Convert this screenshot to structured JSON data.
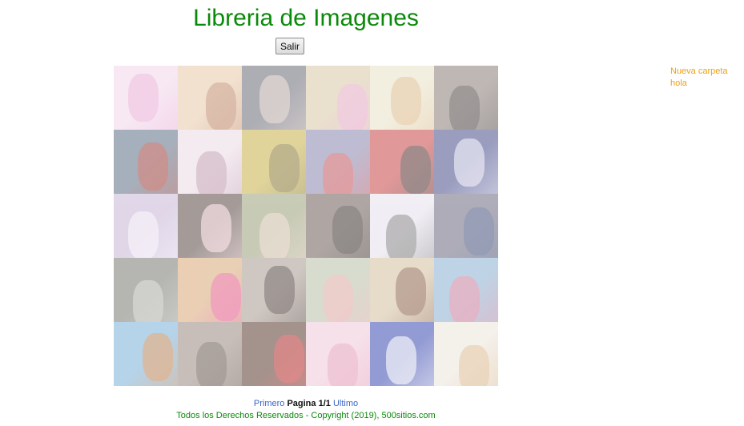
{
  "header": {
    "title": "Libreria de Imagenes",
    "logout_label": "Salir"
  },
  "gallery": {
    "columns": 6,
    "rows": 5,
    "thumbnails": [
      {
        "name": "thumb-1",
        "bg": "#f1d6ea",
        "accent": "#e8a0d0"
      },
      {
        "name": "thumb-2",
        "bg": "#e9c9a8",
        "accent": "#b5785a"
      },
      {
        "name": "thumb-3",
        "bg": "#6b6b78",
        "accent": "#c9b8b0"
      },
      {
        "name": "thumb-4",
        "bg": "#d8c7a6",
        "accent": "#e6a0c8"
      },
      {
        "name": "thumb-5",
        "bg": "#e9e2c8",
        "accent": "#d9b07a"
      },
      {
        "name": "thumb-6",
        "bg": "#8a7e78",
        "accent": "#3d3434"
      },
      {
        "name": "thumb-7",
        "bg": "#5f6f86",
        "accent": "#a83228"
      },
      {
        "name": "thumb-8",
        "bg": "#ecdce6",
        "accent": "#b48aa0"
      },
      {
        "name": "thumb-9",
        "bg": "#c9b24a",
        "accent": "#7a6a2c"
      },
      {
        "name": "thumb-10",
        "bg": "#8a87b0",
        "accent": "#d04848"
      },
      {
        "name": "thumb-11",
        "bg": "#c84444",
        "accent": "#3a2a2a"
      },
      {
        "name": "thumb-12",
        "bg": "#4a4e8c",
        "accent": "#d2d0e8"
      },
      {
        "name": "thumb-13",
        "bg": "#c7b6d6",
        "accent": "#efe6f4"
      },
      {
        "name": "thumb-14",
        "bg": "#5a4a44",
        "accent": "#e8c0c8"
      },
      {
        "name": "thumb-15",
        "bg": "#9aa07a",
        "accent": "#d9c4b0"
      },
      {
        "name": "thumb-16",
        "bg": "#6e5e58",
        "accent": "#2e2622"
      },
      {
        "name": "thumb-17",
        "bg": "#e6e0ec",
        "accent": "#6a6a6a"
      },
      {
        "name": "thumb-18",
        "bg": "#6e6a80",
        "accent": "#3a4a7a"
      },
      {
        "name": "thumb-19",
        "bg": "#7a7a74",
        "accent": "#b8b8b0"
      },
      {
        "name": "thumb-20",
        "bg": "#d8a878",
        "accent": "#e44a8a"
      },
      {
        "name": "thumb-21",
        "bg": "#a89a90",
        "accent": "#3a2a26"
      },
      {
        "name": "thumb-22",
        "bg": "#b8c0a8",
        "accent": "#e8a0a0"
      },
      {
        "name": "thumb-23",
        "bg": "#d4c0a0",
        "accent": "#7a4a30"
      },
      {
        "name": "thumb-24",
        "bg": "#8ab0d0",
        "accent": "#d87090"
      },
      {
        "name": "thumb-25",
        "bg": "#7ab0d8",
        "accent": "#c87a3a"
      },
      {
        "name": "thumb-26",
        "bg": "#9a8a80",
        "accent": "#5a4a40"
      },
      {
        "name": "thumb-27",
        "bg": "#5a3a30",
        "accent": "#c82828"
      },
      {
        "name": "thumb-28",
        "bg": "#f0c8d8",
        "accent": "#e090b0"
      },
      {
        "name": "thumb-29",
        "bg": "#3a4ab0",
        "accent": "#e0e0f0"
      },
      {
        "name": "thumb-30",
        "bg": "#ece4da",
        "accent": "#d8b080"
      }
    ]
  },
  "folders": [
    {
      "label": "Nueva carpeta"
    },
    {
      "label": "hola"
    }
  ],
  "pagination": {
    "first_label": "Primero",
    "page_label": "Pagina 1/1",
    "last_label": "Ultimo"
  },
  "footer": {
    "copyright": "Todos los Derechos Reservados - Copyright (2019), 500sitios.com"
  },
  "colors": {
    "title": "#0a8a0a",
    "folder_link": "#f0a010",
    "pager_link": "#3a66c9"
  }
}
